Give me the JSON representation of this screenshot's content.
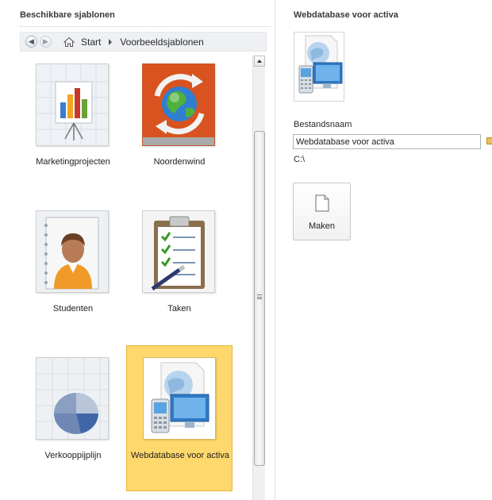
{
  "left": {
    "title": "Beschikbare sjablonen",
    "breadcrumb": {
      "home": "Start",
      "current": "Voorbeeldsjablonen"
    },
    "tiles": [
      {
        "label": "Marketingprojecten",
        "icon": "presentation-chart-icon"
      },
      {
        "label": "Noordenwind",
        "icon": "globe-arrows-icon"
      },
      {
        "label": "Studenten",
        "icon": "student-person-icon"
      },
      {
        "label": "Taken",
        "icon": "clipboard-checklist-icon"
      },
      {
        "label": "Verkooppijplijn",
        "icon": "pie-chart-icon"
      },
      {
        "label": "Webdatabase voor activa",
        "icon": "web-database-devices-icon",
        "selected": true
      }
    ]
  },
  "right": {
    "title": "Webdatabase voor activa",
    "filename_label": "Bestandsnaam",
    "filename_value": "Webdatabase voor activa",
    "path": "C:\\",
    "create_label": "Maken"
  },
  "colors": {
    "selected_tile_bg": "#fed86d",
    "selected_tile_border": "#e5b73e"
  }
}
